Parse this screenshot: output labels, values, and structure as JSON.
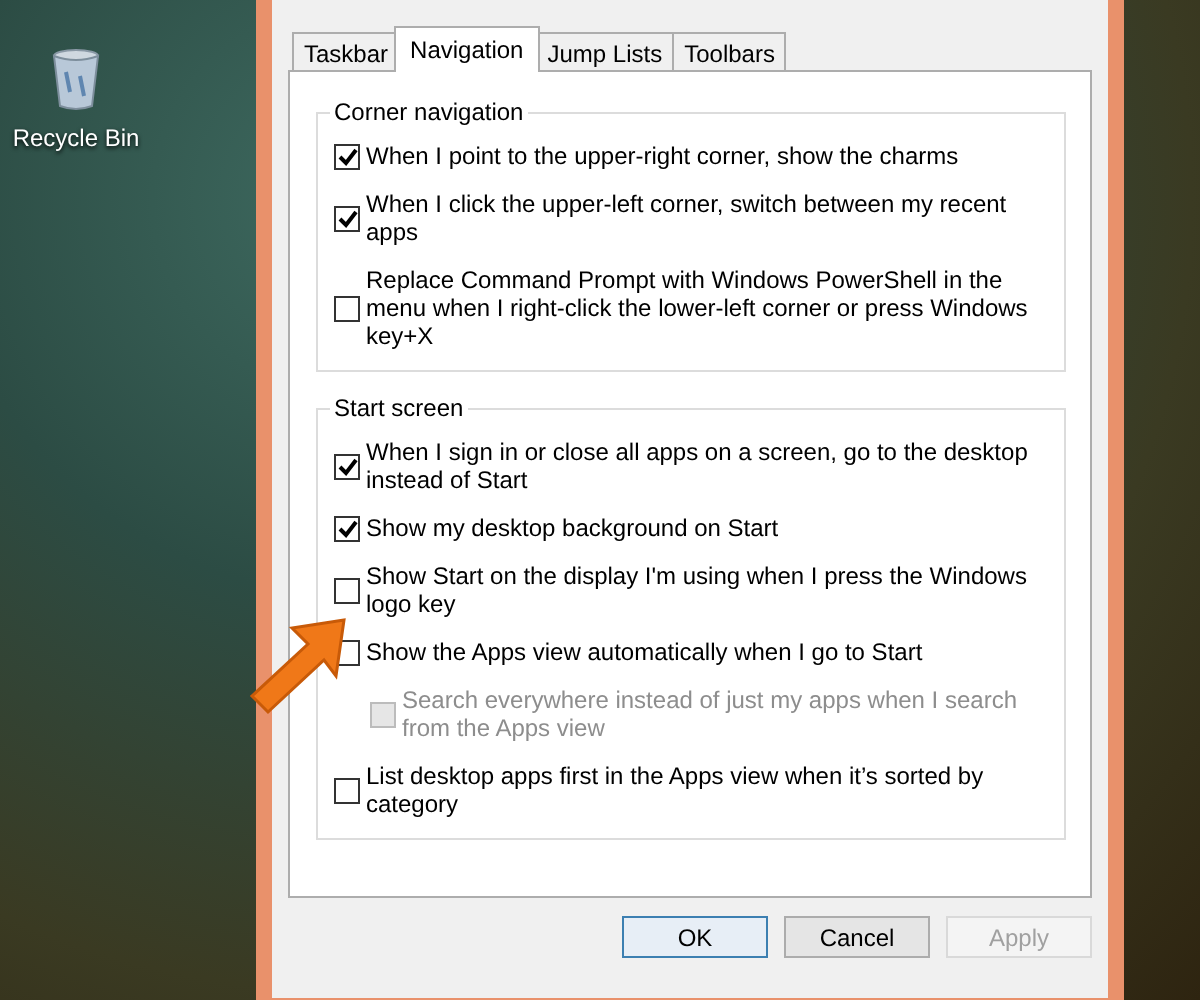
{
  "desktop": {
    "icons": [
      {
        "label": "Recycle Bin"
      }
    ]
  },
  "dialog": {
    "tabs": [
      {
        "label": "Taskbar",
        "selected": false
      },
      {
        "label": "Navigation",
        "selected": true
      },
      {
        "label": "Jump Lists",
        "selected": false
      },
      {
        "label": "Toolbars",
        "selected": false
      }
    ],
    "groups": [
      {
        "title": "Corner navigation",
        "options": [
          {
            "label": "When I point to the upper-right corner, show the charms",
            "checked": true,
            "disabled": false
          },
          {
            "label": "When I click the upper-left corner, switch between my recent apps",
            "checked": true,
            "disabled": false
          },
          {
            "label": "Replace Command Prompt with Windows PowerShell in the menu when I right-click the lower-left corner or press Windows key+X",
            "checked": false,
            "disabled": false
          }
        ]
      },
      {
        "title": "Start screen",
        "options": [
          {
            "label": "When I sign in or close all apps on a screen, go to the desktop instead of Start",
            "checked": true,
            "disabled": false
          },
          {
            "label": "Show my desktop background on Start",
            "checked": true,
            "disabled": false
          },
          {
            "label": "Show Start on the display I'm using when I press the Windows logo key",
            "checked": false,
            "disabled": false
          },
          {
            "label": "Show the Apps view automatically when I go to Start",
            "checked": false,
            "disabled": false,
            "children": [
              {
                "label": "Search everywhere instead of just my apps when I search from the Apps view",
                "checked": false,
                "disabled": true
              }
            ]
          },
          {
            "label": "List desktop apps first in the Apps view when it’s sorted by category",
            "checked": false,
            "disabled": false
          }
        ]
      }
    ],
    "buttons": [
      {
        "label": "OK",
        "default": true,
        "disabled": false
      },
      {
        "label": "Cancel",
        "default": false,
        "disabled": false
      },
      {
        "label": "Apply",
        "default": false,
        "disabled": true
      }
    ]
  }
}
